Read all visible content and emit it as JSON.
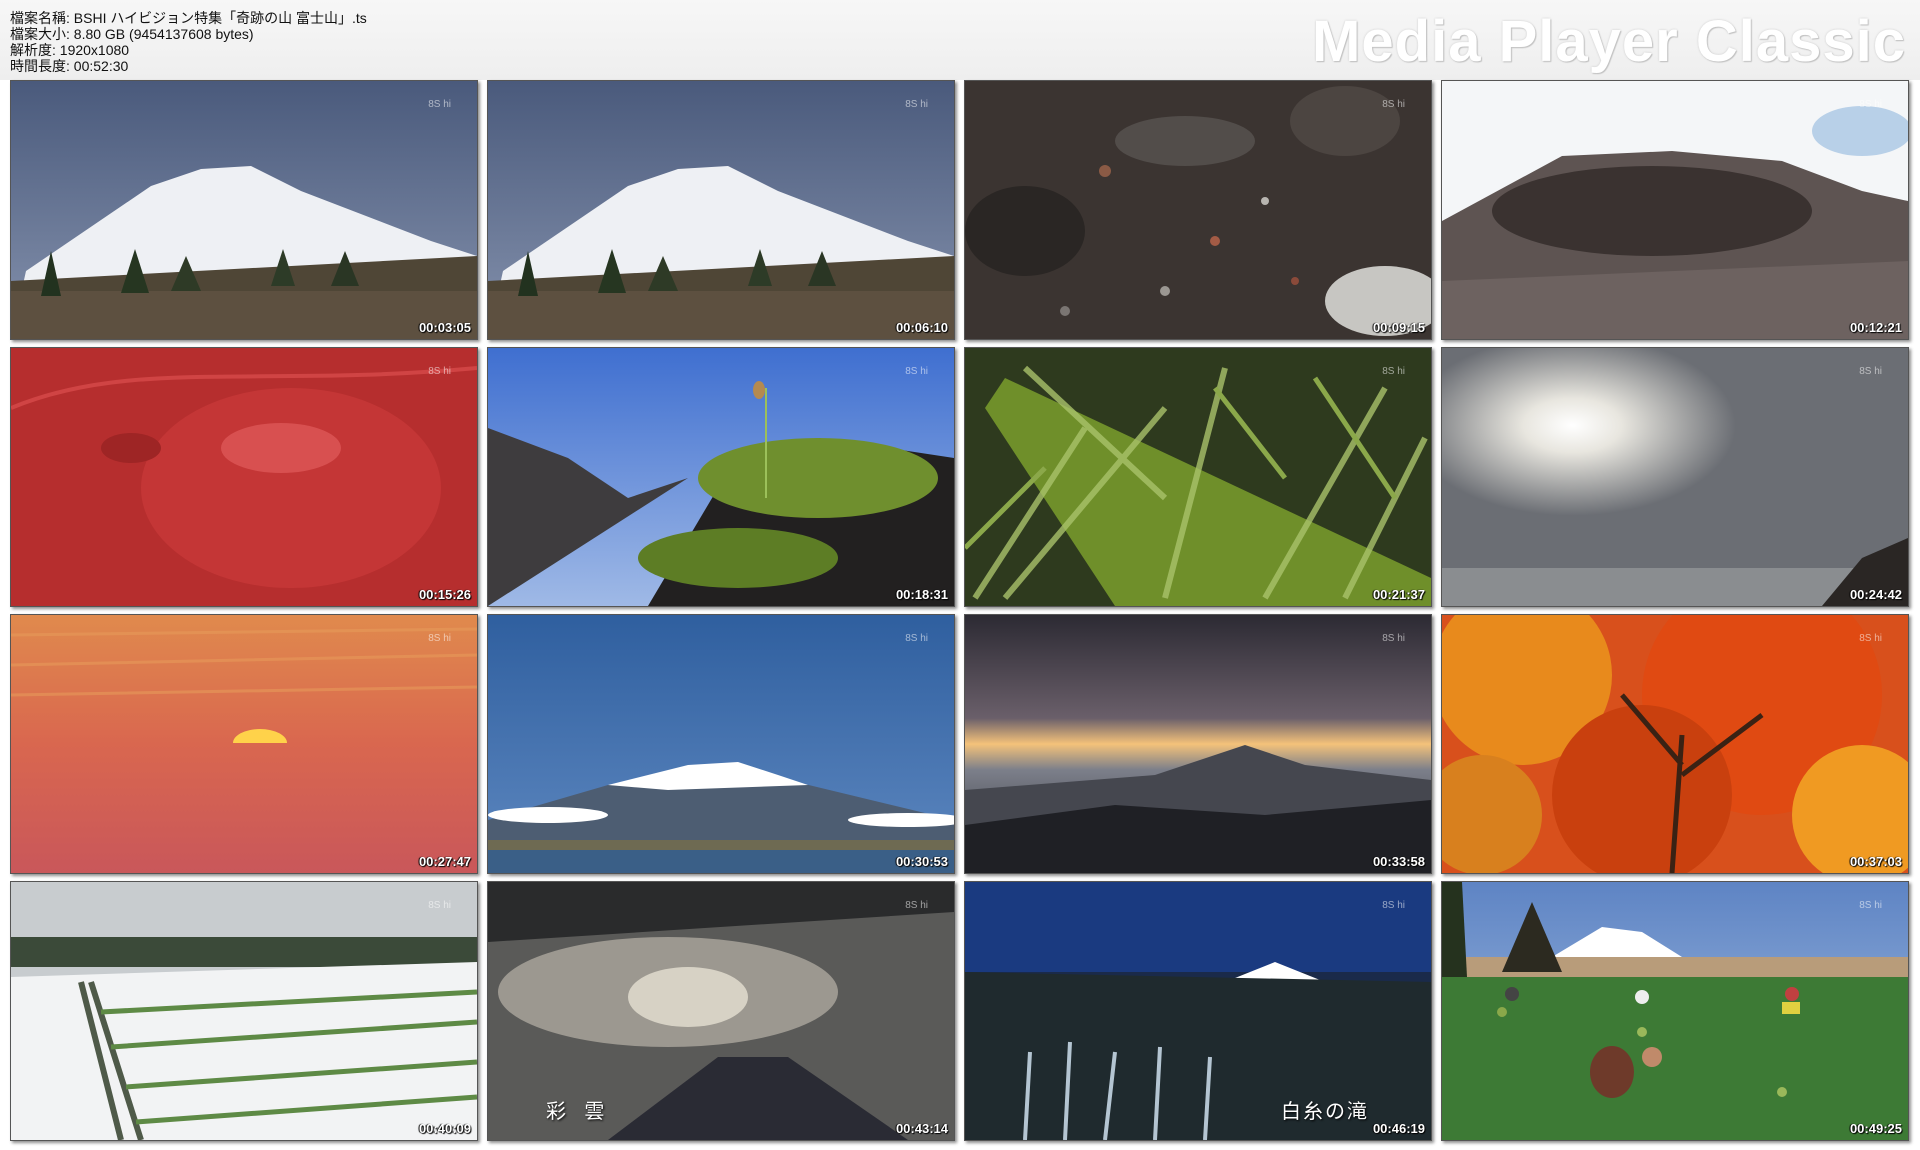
{
  "file_info": {
    "name": "檔案名稱: BSHI ハイビジョン特集「奇跡の山 富士山」.ts",
    "size": "檔案大小: 8.80 GB (9454137608 bytes)",
    "resolution": "解析度: 1920x1080",
    "duration": "時間長度: 00:52:30"
  },
  "brand": "Media Player Classic",
  "watermark": "8S hi",
  "thumbnails": [
    {
      "timestamp": "00:03:05",
      "scene": "snowy-mountain-forest"
    },
    {
      "timestamp": "00:06:10",
      "scene": "snowy-mountain-forest"
    },
    {
      "timestamp": "00:09:15",
      "scene": "volcanic-rocks"
    },
    {
      "timestamp": "00:12:21",
      "scene": "crater"
    },
    {
      "timestamp": "00:15:26",
      "scene": "red-relief-map"
    },
    {
      "timestamp": "00:18:31",
      "scene": "seedling-on-moss"
    },
    {
      "timestamp": "00:21:37",
      "scene": "bamboo-mossy-log"
    },
    {
      "timestamp": "00:24:42",
      "scene": "sun-through-clouds"
    },
    {
      "timestamp": "00:27:47",
      "scene": "orange-sunset"
    },
    {
      "timestamp": "00:30:53",
      "scene": "fuji-blue-sky"
    },
    {
      "timestamp": "00:33:58",
      "scene": "fuji-dawn-silhouette"
    },
    {
      "timestamp": "00:37:03",
      "scene": "autumn-maple"
    },
    {
      "timestamp": "00:40:09",
      "scene": "snowy-fields"
    },
    {
      "timestamp": "00:43:14",
      "scene": "iridescent-clouds",
      "caption": "彩 雲"
    },
    {
      "timestamp": "00:46:19",
      "scene": "shiraito-falls",
      "caption": "白糸の滝"
    },
    {
      "timestamp": "00:49:25",
      "scene": "farm-field-fuji"
    }
  ]
}
